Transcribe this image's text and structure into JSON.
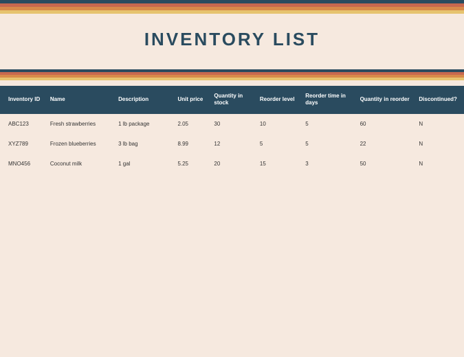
{
  "colors": {
    "navy": "#2a4b5f",
    "red": "#c7684f",
    "orange": "#d88a4a",
    "yellow": "#e6c36f",
    "bg": "#f6e9df"
  },
  "title": "INVENTORY LIST",
  "table": {
    "headers": [
      "Inventory ID",
      "Name",
      "Description",
      "Unit price",
      "Quantity in stock",
      "Reorder level",
      "Reorder time in days",
      "Quantity in reorder",
      "Discontinued?"
    ],
    "rows": [
      {
        "inventory_id": "ABC123",
        "name": "Fresh strawberries",
        "description": "1 lb package",
        "unit_price": "2.05",
        "quantity_in_stock": "30",
        "reorder_level": "10",
        "reorder_time_days": "5",
        "quantity_in_reorder": "60",
        "discontinued": "N"
      },
      {
        "inventory_id": "XYZ789",
        "name": "Frozen blueberries",
        "description": "3 lb bag",
        "unit_price": "8.99",
        "quantity_in_stock": "12",
        "reorder_level": "5",
        "reorder_time_days": "5",
        "quantity_in_reorder": "22",
        "discontinued": "N"
      },
      {
        "inventory_id": "MNO456",
        "name": "Coconut milk",
        "description": "1 gal",
        "unit_price": "5.25",
        "quantity_in_stock": "20",
        "reorder_level": "15",
        "reorder_time_days": "3",
        "quantity_in_reorder": "50",
        "discontinued": "N"
      }
    ]
  }
}
